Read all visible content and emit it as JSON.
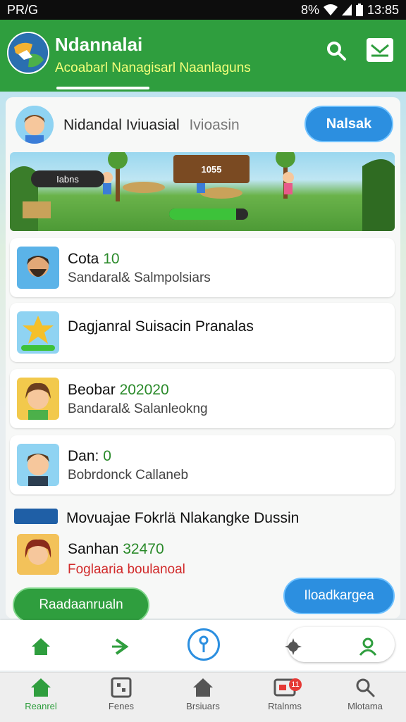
{
  "status_bar": {
    "carrier": "PR/G",
    "battery": "8%",
    "time": "13:85"
  },
  "header": {
    "title": "Ndannalai",
    "subtitle": "Acoabarl Nanagisarl Naanlaguns",
    "search_icon": "search-icon",
    "mail_icon": "mail-icon"
  },
  "profile": {
    "name": "Nidandal",
    "name2": "Iviuasial",
    "sub": "Ivioasin",
    "action_label": "Nalsak"
  },
  "banner": {
    "sign_text": "1055",
    "tag_text": "Iabns",
    "progress": 0.85
  },
  "list": [
    {
      "title": "Cota",
      "value": "10",
      "subtitle": "Sandaral& Salmpolsiars"
    },
    {
      "title": "Dagjanral Suisacin Pranalas",
      "value": "",
      "subtitle": ""
    },
    {
      "title": "Beobar",
      "value": "202020",
      "subtitle": "Bandaral& Salanleokng"
    },
    {
      "title": "Dan:",
      "value": "0",
      "subtitle": "Bobrdonck Callaneb"
    }
  ],
  "row5": {
    "title": "Movuajae Fokrlä Nlakangke Dussin",
    "name": "Sanhan",
    "value": "32470",
    "note": "Foglaaria boulanoal"
  },
  "buttons": {
    "left_fab": "Raadaanrualn",
    "right_fab": "Iloadkargea"
  },
  "bottom_nav": [
    {
      "label": "Reanrel",
      "icon": "home-icon",
      "active": true
    },
    {
      "label": "Fenes",
      "icon": "grid-icon",
      "active": false
    },
    {
      "label": "Brsiuars",
      "icon": "house-icon",
      "active": false
    },
    {
      "label": "Rtalnms",
      "icon": "message-icon",
      "active": false,
      "badge": "11"
    },
    {
      "label": "Mlotama",
      "icon": "search-icon",
      "active": false
    }
  ],
  "colors": {
    "primary_green": "#2f9e3e",
    "accent_blue": "#2c8fe0",
    "subtitle_yellow": "#f4ff7a",
    "value_green": "#2a8a2a",
    "alert_red": "#d12a2a"
  }
}
